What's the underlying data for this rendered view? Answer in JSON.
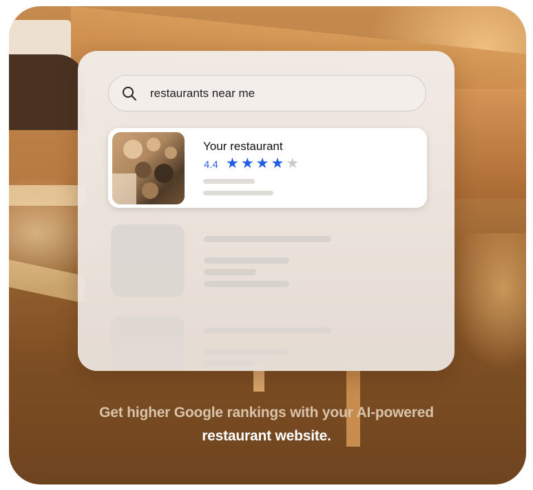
{
  "search": {
    "query": "restaurants near me",
    "icon": "search-icon"
  },
  "result": {
    "name": "Your restaurant",
    "rating": "4.4",
    "stars_filled": 4,
    "stars_total": 5,
    "star_color": "#1f5de6"
  },
  "tagline": {
    "line1": "Get higher Google rankings with your AI-powered",
    "line2": "restaurant website."
  }
}
